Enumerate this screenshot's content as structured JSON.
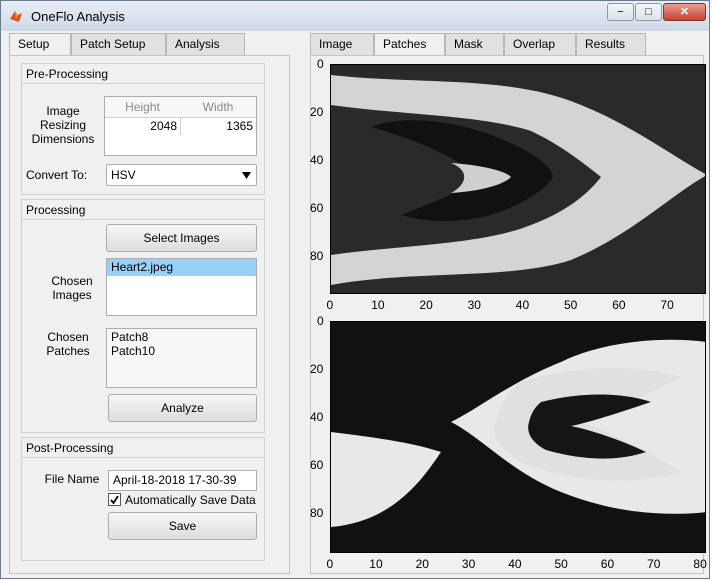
{
  "window": {
    "title": "OneFlo Analysis",
    "controls": {
      "minimize": "−",
      "maximize": "□",
      "close": "✕"
    }
  },
  "left_tabs": [
    "Setup",
    "Patch Setup",
    "Analysis"
  ],
  "right_tabs": [
    "Image",
    "Patches",
    "Mask",
    "Overlap",
    "Results"
  ],
  "pre_processing": {
    "title": "Pre-Processing",
    "resize_label": "Image Resizing Dimensions",
    "height_header": "Height",
    "width_header": "Width",
    "height": "2048",
    "width": "1365",
    "convert_label": "Convert To:",
    "convert_value": "HSV"
  },
  "processing": {
    "title": "Processing",
    "select_button": "Select Images",
    "chosen_images_label": "Chosen Images",
    "images": [
      "Heart2.jpeg"
    ],
    "chosen_patches_label": "Chosen Patches",
    "patches": [
      "Patch8",
      "Patch10"
    ],
    "analyze_button": "Analyze"
  },
  "post_processing": {
    "title": "Post-Processing",
    "file_name_label": "File Name",
    "file_name": "April-18-2018 17-30-39",
    "autosave_label": "Automatically Save Data",
    "autosave_checked": true,
    "save_button": "Save"
  },
  "plots": [
    {
      "y_ticks": [
        "0",
        "20",
        "40",
        "60",
        "80"
      ],
      "x_ticks": [
        "0",
        "10",
        "20",
        "30",
        "40",
        "50",
        "60",
        "70"
      ]
    },
    {
      "y_ticks": [
        "0",
        "20",
        "40",
        "60",
        "80"
      ],
      "x_ticks": [
        "0",
        "10",
        "20",
        "30",
        "40",
        "50",
        "60",
        "70",
        "80"
      ]
    }
  ],
  "icons": {
    "app": "matlab-icon",
    "dropdown": "triangle-down-icon",
    "check": "checkmark-icon"
  }
}
